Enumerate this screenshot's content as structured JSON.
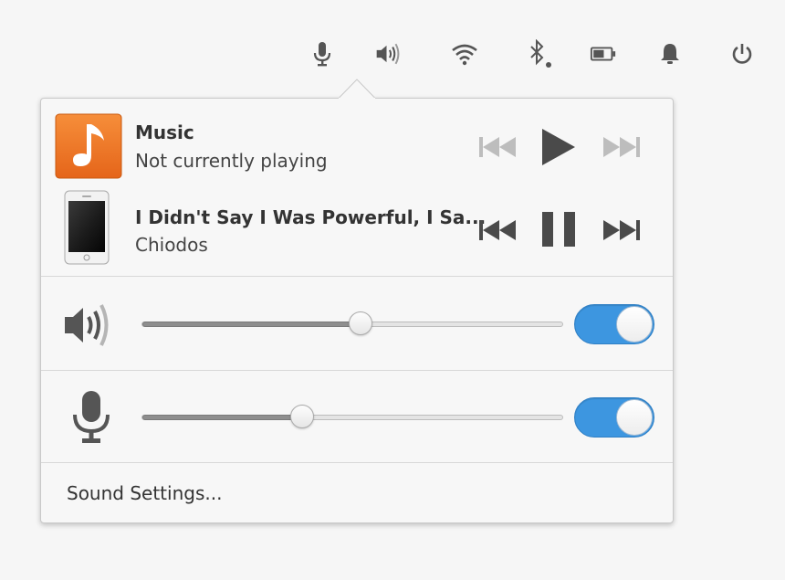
{
  "topbar": {
    "icons": [
      "microphone-icon",
      "volume-icon",
      "wifi-icon",
      "bluetooth-icon",
      "battery-icon",
      "notifications-icon",
      "power-icon"
    ]
  },
  "players": [
    {
      "title": "Music",
      "subtitle": "Not currently playing",
      "art_icon": "music-note-icon",
      "state": "stopped"
    },
    {
      "title": "I Didn't Say I Was Powerful, I Sa...",
      "subtitle": "Chiodos",
      "art_icon": "phone-icon",
      "state": "playing"
    }
  ],
  "output": {
    "level": 0.52,
    "enabled": true
  },
  "input": {
    "level": 0.38,
    "enabled": true
  },
  "settings_label": "Sound Settings...",
  "colors": {
    "accent": "#3d96e0",
    "music_orange": "#f07a21",
    "icon_gray": "#555555",
    "disabled_gray": "#bdbdbd"
  }
}
